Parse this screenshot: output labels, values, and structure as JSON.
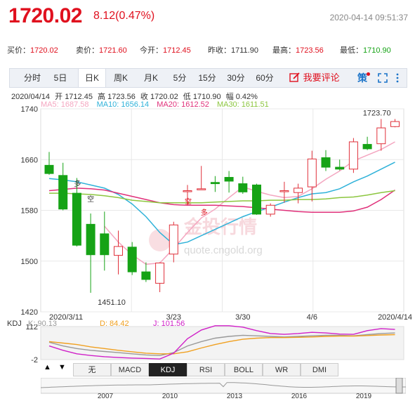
{
  "header": {
    "price": "1720.02",
    "change": "8.12(0.47%)",
    "datetime": "2020-04-14 09:51:37"
  },
  "quotes": {
    "buy_label": "买价：",
    "buy_value": "1720.02",
    "sell_label": "卖价：",
    "sell_value": "1721.60",
    "open_label": "今开：",
    "open_value": "1712.45",
    "prev_label": "昨收：",
    "prev_value": "1711.90",
    "high_label": "最高：",
    "high_value": "1723.56",
    "low_label": "最低：",
    "low_value": "1710.90"
  },
  "tabs": [
    "分时",
    "5日",
    "日K",
    "周K",
    "月K",
    "5分",
    "15分",
    "30分",
    "60分"
  ],
  "active_tab": "日K",
  "comment_label": "我要评论",
  "info": {
    "date": "2020/04/14",
    "open_label": "开",
    "open": "1712.45",
    "high_label": "高",
    "high": "1723.56",
    "close_label": "收",
    "close": "1720.02",
    "low_label": "低",
    "low": "1710.90",
    "amp_label": "幅",
    "amp": "0.42%"
  },
  "ma_legend": [
    {
      "label": "MA5: 1687.58",
      "color": "#f4a6c0"
    },
    {
      "label": "MA10: 1656.14",
      "color": "#2fb2d9"
    },
    {
      "label": "MA20: 1612.52",
      "color": "#e0307a"
    },
    {
      "label": "MA30: 1611.51",
      "color": "#8cc63f"
    }
  ],
  "kdj": {
    "title": "KDJ",
    "k": "K: 90.13",
    "d": "D: 84.42",
    "j": "J: 101.56",
    "k_color": "#999999",
    "d_color": "#f0a020",
    "j_color": "#d020c8",
    "y_ticks": [
      "112",
      "-2"
    ]
  },
  "indicator_tabs": [
    "无",
    "MACD",
    "KDJ",
    "RSI",
    "BOLL",
    "WR",
    "DMI"
  ],
  "active_indicator": "KDJ",
  "overview_years": [
    "2007",
    "2010",
    "2013",
    "2016",
    "2019"
  ],
  "watermark": {
    "brand": "金投行情",
    "url": "quote.cngold.org"
  },
  "chart_data": {
    "type": "candlestick",
    "y_ticks": [
      1740,
      1660,
      1580,
      1500,
      1420
    ],
    "ylim": [
      1420,
      1740
    ],
    "x_tick_labels": [
      "2020/3/11",
      "3/23",
      "3/30",
      "4/6",
      "2020/4/14"
    ],
    "max_label": "1723.70",
    "min_label": "1451.10",
    "up_color": "#e0303a",
    "down_color": "#16a316",
    "annotations": [
      "空",
      "多",
      "空",
      "多"
    ],
    "candles": [
      {
        "o": 1651,
        "h": 1672,
        "l": 1636,
        "c": 1638
      },
      {
        "o": 1635,
        "h": 1655,
        "l": 1580,
        "c": 1582
      },
      {
        "o": 1607,
        "h": 1631,
        "l": 1523,
        "c": 1525
      },
      {
        "o": 1558,
        "h": 1575,
        "l": 1450,
        "c": 1510
      },
      {
        "o": 1543,
        "h": 1578,
        "l": 1485,
        "c": 1510
      },
      {
        "o": 1509,
        "h": 1548,
        "l": 1479,
        "c": 1523
      },
      {
        "o": 1522,
        "h": 1530,
        "l": 1478,
        "c": 1483
      },
      {
        "o": 1483,
        "h": 1498,
        "l": 1467,
        "c": 1471
      },
      {
        "o": 1465,
        "h": 1498,
        "l": 1451,
        "c": 1497
      },
      {
        "o": 1511,
        "h": 1562,
        "l": 1498,
        "c": 1557
      },
      {
        "o": 1610,
        "h": 1620,
        "l": 1588,
        "c": 1611
      },
      {
        "o": 1614,
        "h": 1650,
        "l": 1614,
        "c": 1614
      },
      {
        "o": 1624,
        "h": 1634,
        "l": 1609,
        "c": 1622
      },
      {
        "o": 1632,
        "h": 1642,
        "l": 1608,
        "c": 1626
      },
      {
        "o": 1622,
        "h": 1633,
        "l": 1606,
        "c": 1609
      },
      {
        "o": 1620,
        "h": 1622,
        "l": 1573,
        "c": 1574
      },
      {
        "o": 1574,
        "h": 1591,
        "l": 1570,
        "c": 1588
      },
      {
        "o": 1611,
        "h": 1625,
        "l": 1592,
        "c": 1611
      },
      {
        "o": 1608,
        "h": 1622,
        "l": 1591,
        "c": 1615
      },
      {
        "o": 1617,
        "h": 1674,
        "l": 1594,
        "c": 1661
      },
      {
        "o": 1663,
        "h": 1675,
        "l": 1642,
        "c": 1648
      },
      {
        "o": 1648,
        "h": 1660,
        "l": 1643,
        "c": 1645
      },
      {
        "o": 1645,
        "h": 1694,
        "l": 1639,
        "c": 1688
      },
      {
        "o": 1684,
        "h": 1696,
        "l": 1675,
        "c": 1677
      },
      {
        "o": 1685,
        "h": 1724,
        "l": 1674,
        "c": 1710
      },
      {
        "o": 1712,
        "h": 1724,
        "l": 1711,
        "c": 1720
      }
    ],
    "series": [
      {
        "name": "MA5",
        "color": "#f4a6c0",
        "values": [
          null,
          null,
          null,
          null,
          1555,
          1530,
          1510,
          1495,
          1497,
          1520,
          1545,
          1568,
          1582,
          1600,
          1617,
          1610,
          1604,
          1600,
          1602,
          1614,
          1629,
          1642,
          1658,
          1667,
          1676,
          1688
        ]
      },
      {
        "name": "MA10",
        "color": "#2fb2d9",
        "values": [
          1630,
          1628,
          1625,
          1620,
          1615,
          1605,
          1590,
          1570,
          1545,
          1526,
          1530,
          1540,
          1550,
          1560,
          1570,
          1578,
          1585,
          1593,
          1600,
          1606,
          1608,
          1614,
          1625,
          1634,
          1645,
          1656
        ]
      },
      {
        "name": "MA20",
        "color": "#e0307a",
        "values": [
          1611,
          1613,
          1615,
          1614,
          1612,
          1607,
          1602,
          1597,
          1592,
          1589,
          1588,
          1588,
          1588,
          1587,
          1586,
          1584,
          1582,
          1580,
          1578,
          1577,
          1577,
          1577,
          1579,
          1585,
          1597,
          1612
        ]
      },
      {
        "name": "MA30",
        "color": "#8cc63f",
        "values": [
          1607,
          1607,
          1606,
          1605,
          1603,
          1600,
          1596,
          1594,
          1592,
          1592,
          1592,
          1592,
          1593,
          1594,
          1595,
          1595,
          1596,
          1596,
          1597,
          1597,
          1598,
          1600,
          1601,
          1604,
          1608,
          1611
        ]
      }
    ],
    "kdj_series": {
      "ylim": [
        -2,
        112
      ],
      "K": [
        58,
        45,
        36,
        30,
        26,
        22,
        18,
        14,
        12,
        22,
        45,
        60,
        72,
        78,
        82,
        80,
        78,
        76,
        78,
        80,
        82,
        82,
        80,
        84,
        88,
        90
      ],
      "D": [
        60,
        55,
        50,
        42,
        36,
        30,
        25,
        20,
        18,
        18,
        25,
        38,
        50,
        60,
        68,
        72,
        74,
        74,
        75,
        76,
        78,
        79,
        79,
        81,
        83,
        84
      ],
      "J": [
        45,
        30,
        18,
        12,
        8,
        5,
        3,
        2,
        0,
        20,
        70,
        100,
        115,
        115,
        110,
        98,
        88,
        85,
        88,
        92,
        90,
        86,
        85,
        98,
        105,
        102
      ]
    }
  }
}
